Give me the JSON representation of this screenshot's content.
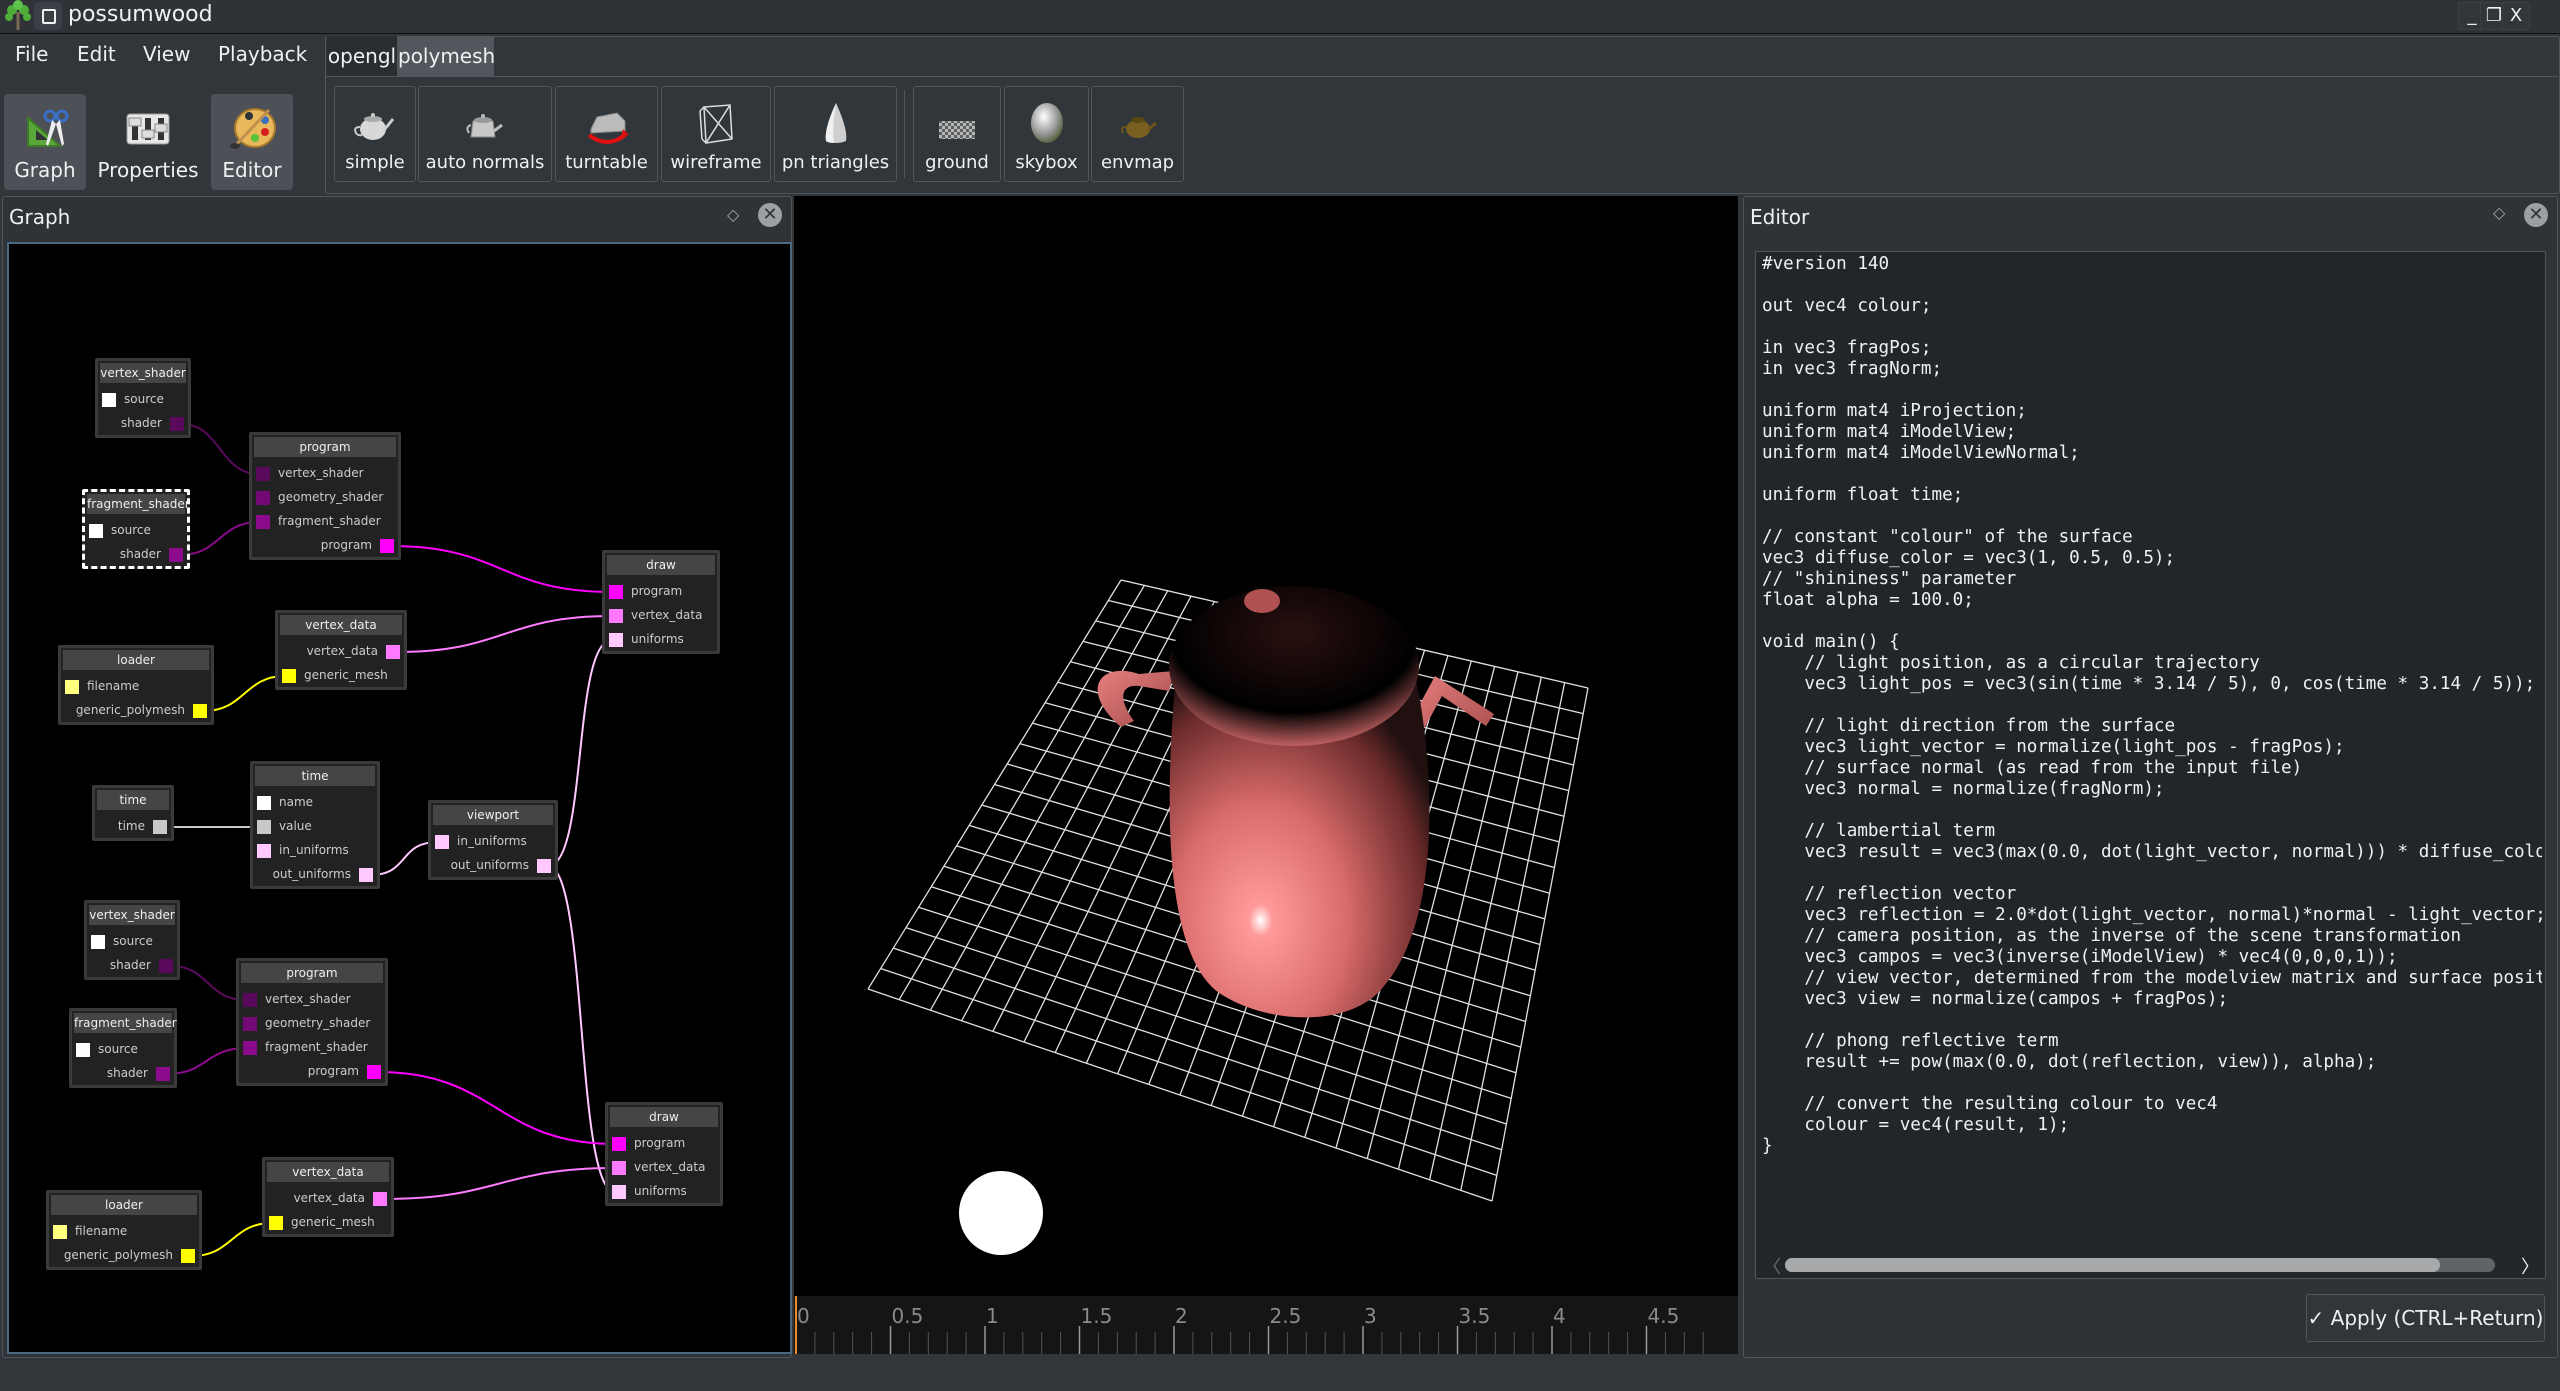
{
  "window": {
    "title": "possumwood",
    "controls": [
      "minimize-icon",
      "maximize-icon",
      "close-icon"
    ]
  },
  "menubar": [
    "File",
    "Edit",
    "View",
    "Playback"
  ],
  "dock_toggles": [
    {
      "label": "Graph",
      "icon": "graph-tools-icon",
      "active": true
    },
    {
      "label": "Properties",
      "icon": "properties-sliders-icon",
      "active": false
    },
    {
      "label": "Editor",
      "icon": "paint-palette-icon",
      "active": true
    }
  ],
  "toolbar": {
    "tabs": [
      {
        "label": "opengl",
        "active": false
      },
      {
        "label": "polymesh",
        "active": true
      }
    ],
    "tools": [
      {
        "label": "simple",
        "icon": "teapot-icon"
      },
      {
        "label": "auto normals",
        "icon": "teapot-faceted-icon"
      },
      {
        "label": "turntable",
        "icon": "car-rotate-icon"
      },
      {
        "label": "wireframe",
        "icon": "wireframe-box-icon"
      },
      {
        "label": "pn triangles",
        "icon": "cone-icon"
      },
      {
        "label": "ground",
        "icon": "ground-plane-icon"
      },
      {
        "label": "skybox",
        "icon": "skybox-sphere-icon"
      },
      {
        "label": "envmap",
        "icon": "envmap-teapot-icon"
      }
    ]
  },
  "graph_panel": {
    "title": "Graph",
    "nodes": [
      {
        "id": "vs1",
        "title": "vertex_shader",
        "ports": [
          {
            "name": "source",
            "side": "in",
            "color": "#ffffff"
          },
          {
            "name": "shader",
            "side": "out",
            "color": "#5a0a5a"
          }
        ]
      },
      {
        "id": "fs1",
        "title": "fragment_shader",
        "selected": true,
        "ports": [
          {
            "name": "source",
            "side": "in",
            "color": "#ffffff"
          },
          {
            "name": "shader",
            "side": "out",
            "color": "#8c0a8c"
          }
        ]
      },
      {
        "id": "prog1",
        "title": "program",
        "ports": [
          {
            "name": "vertex_shader",
            "side": "in",
            "color": "#5a0a5a"
          },
          {
            "name": "geometry_shader",
            "side": "in",
            "color": "#730a73"
          },
          {
            "name": "fragment_shader",
            "side": "in",
            "color": "#8c0a8c"
          },
          {
            "name": "program",
            "side": "out",
            "color": "#ff00ff"
          }
        ]
      },
      {
        "id": "draw1",
        "title": "draw",
        "ports": [
          {
            "name": "program",
            "side": "in",
            "color": "#ff00ff"
          },
          {
            "name": "vertex_data",
            "side": "in",
            "color": "#ff7aff"
          },
          {
            "name": "uniforms",
            "side": "in",
            "color": "#ffc8ff"
          }
        ]
      },
      {
        "id": "vd1",
        "title": "vertex_data",
        "ports": [
          {
            "name": "vertex_data",
            "side": "out",
            "color": "#ff7aff"
          },
          {
            "name": "generic_mesh",
            "side": "in",
            "color": "#ffff00"
          }
        ]
      },
      {
        "id": "ld1",
        "title": "loader",
        "ports": [
          {
            "name": "filename",
            "side": "in",
            "color": "#ffff80"
          },
          {
            "name": "generic_polymesh",
            "side": "out",
            "color": "#ffff00"
          }
        ]
      },
      {
        "id": "tsrc",
        "title": "time",
        "ports": [
          {
            "name": "time",
            "side": "out",
            "color": "#c8c8c8"
          }
        ]
      },
      {
        "id": "tnode",
        "title": "time",
        "ports": [
          {
            "name": "name",
            "side": "in",
            "color": "#ffffff"
          },
          {
            "name": "value",
            "side": "in",
            "color": "#c8c8c8"
          },
          {
            "name": "in_uniforms",
            "side": "in",
            "color": "#ffc8ff"
          },
          {
            "name": "out_uniforms",
            "side": "out",
            "color": "#ffc8ff"
          }
        ]
      },
      {
        "id": "vp",
        "title": "viewport",
        "ports": [
          {
            "name": "in_uniforms",
            "side": "in",
            "color": "#ffc8ff"
          },
          {
            "name": "out_uniforms",
            "side": "out",
            "color": "#ffc8ff"
          }
        ]
      },
      {
        "id": "vs2",
        "title": "vertex_shader",
        "ports": [
          {
            "name": "source",
            "side": "in",
            "color": "#ffffff"
          },
          {
            "name": "shader",
            "side": "out",
            "color": "#5a0a5a"
          }
        ]
      },
      {
        "id": "fs2",
        "title": "fragment_shader",
        "ports": [
          {
            "name": "source",
            "side": "in",
            "color": "#ffffff"
          },
          {
            "name": "shader",
            "side": "out",
            "color": "#8c0a8c"
          }
        ]
      },
      {
        "id": "prog2",
        "title": "program",
        "ports": [
          {
            "name": "vertex_shader",
            "side": "in",
            "color": "#5a0a5a"
          },
          {
            "name": "geometry_shader",
            "side": "in",
            "color": "#730a73"
          },
          {
            "name": "fragment_shader",
            "side": "in",
            "color": "#8c0a8c"
          },
          {
            "name": "program",
            "side": "out",
            "color": "#ff00ff"
          }
        ]
      },
      {
        "id": "draw2",
        "title": "draw",
        "ports": [
          {
            "name": "program",
            "side": "in",
            "color": "#ff00ff"
          },
          {
            "name": "vertex_data",
            "side": "in",
            "color": "#ff7aff"
          },
          {
            "name": "uniforms",
            "side": "in",
            "color": "#ffc8ff"
          }
        ]
      },
      {
        "id": "vd2",
        "title": "vertex_data",
        "ports": [
          {
            "name": "vertex_data",
            "side": "out",
            "color": "#ff7aff"
          },
          {
            "name": "generic_mesh",
            "side": "in",
            "color": "#ffff00"
          }
        ]
      },
      {
        "id": "ld2",
        "title": "loader",
        "ports": [
          {
            "name": "filename",
            "side": "in",
            "color": "#ffff80"
          },
          {
            "name": "generic_polymesh",
            "side": "out",
            "color": "#ffff00"
          }
        ]
      }
    ],
    "connections": [
      {
        "from": "vs1.shader",
        "to": "prog1.vertex_shader",
        "color": "#5a0a5a"
      },
      {
        "from": "fs1.shader",
        "to": "prog1.fragment_shader",
        "color": "#8c0a8c"
      },
      {
        "from": "prog1.program",
        "to": "draw1.program",
        "color": "#ff00ff"
      },
      {
        "from": "vd1.vertex_data",
        "to": "draw1.vertex_data",
        "color": "#ff7aff"
      },
      {
        "from": "ld1.generic_polymesh",
        "to": "vd1.generic_mesh",
        "color": "#ffff00"
      },
      {
        "from": "tsrc.time",
        "to": "tnode.value",
        "color": "#c8c8c8"
      },
      {
        "from": "tnode.out_uniforms",
        "to": "vp.in_uniforms",
        "color": "#ffc8ff"
      },
      {
        "from": "vp.out_uniforms",
        "to": "draw1.uniforms",
        "color": "#ffc8ff"
      },
      {
        "from": "vp.out_uniforms",
        "to": "draw2.uniforms",
        "color": "#ffc8ff"
      },
      {
        "from": "vs2.shader",
        "to": "prog2.vertex_shader",
        "color": "#5a0a5a"
      },
      {
        "from": "fs2.shader",
        "to": "prog2.fragment_shader",
        "color": "#8c0a8c"
      },
      {
        "from": "prog2.program",
        "to": "draw2.program",
        "color": "#ff00ff"
      },
      {
        "from": "vd2.vertex_data",
        "to": "draw2.vertex_data",
        "color": "#ff7aff"
      },
      {
        "from": "ld2.generic_polymesh",
        "to": "vd2.generic_mesh",
        "color": "#ffff00"
      }
    ]
  },
  "viewport": {
    "scene": "pink teapot on wireframe ground grid with white light sphere",
    "teapot_color": "#e87878",
    "timeline": {
      "labels": [
        "0",
        "0.5",
        "1",
        "1.5",
        "2",
        "2.5",
        "3",
        "3.5",
        "4",
        "4.5"
      ],
      "current_time": 0,
      "cursor_color": "#f08a24"
    }
  },
  "editor_panel": {
    "title": "Editor",
    "code": "#version 140\n\nout vec4 colour;\n\nin vec3 fragPos;\nin vec3 fragNorm;\n\nuniform mat4 iProjection;\nuniform mat4 iModelView;\nuniform mat4 iModelViewNormal;\n\nuniform float time;\n\n// constant \"colour\" of the surface\nvec3 diffuse_color = vec3(1, 0.5, 0.5);\n// \"shininess\" parameter\nfloat alpha = 100.0;\n\nvoid main() {\n    // light position, as a circular trajectory\n    vec3 light_pos = vec3(sin(time * 3.14 / 5), 0, cos(time * 3.14 / 5));\n\n    // light direction from the surface\n    vec3 light_vector = normalize(light_pos - fragPos);\n    // surface normal (as read from the input file)\n    vec3 normal = normalize(fragNorm);\n\n    // lambertial term\n    vec3 result = vec3(max(0.0, dot(light_vector, normal))) * diffuse_color;\n\n    // reflection vector\n    vec3 reflection = 2.0*dot(light_vector, normal)*normal - light_vector;\n    // camera position, as the inverse of the scene transformation\n    vec3 campos = vec3(inverse(iModelView) * vec4(0,0,0,1));\n    // view vector, determined from the modelview matrix and surface position\n    vec3 view = normalize(campos + fragPos);\n\n    // phong reflective term\n    result += pow(max(0.0, dot(reflection, view)), alpha);\n\n    // convert the resulting colour to vec4\n    colour = vec4(result, 1);\n}",
    "horizontal_scroll_fraction": 0.92,
    "apply_button": {
      "label": "Apply (CTRL+Return)",
      "icon": "checkmark-icon"
    }
  }
}
